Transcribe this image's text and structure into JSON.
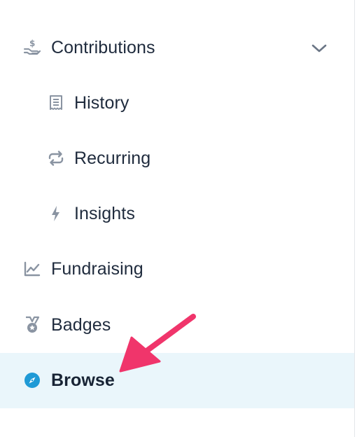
{
  "nav": {
    "contributions": {
      "label": "Contributions",
      "icon": "hand-dollar-icon"
    },
    "history": {
      "label": "History",
      "icon": "receipt-icon"
    },
    "recurring": {
      "label": "Recurring",
      "icon": "repeat-icon"
    },
    "insights": {
      "label": "Insights",
      "icon": "lightning-icon"
    },
    "fundraising": {
      "label": "Fundraising",
      "icon": "trend-chart-icon"
    },
    "badges": {
      "label": "Badges",
      "icon": "medal-icon"
    },
    "browse": {
      "label": "Browse",
      "icon": "compass-icon",
      "active": true
    }
  },
  "colors": {
    "text": "#1f2b3d",
    "icon_gray": "#8a94a2",
    "active_bg": "#eaf6fb",
    "active_icon": "#1f9ad6",
    "arrow": "#f0356b"
  }
}
